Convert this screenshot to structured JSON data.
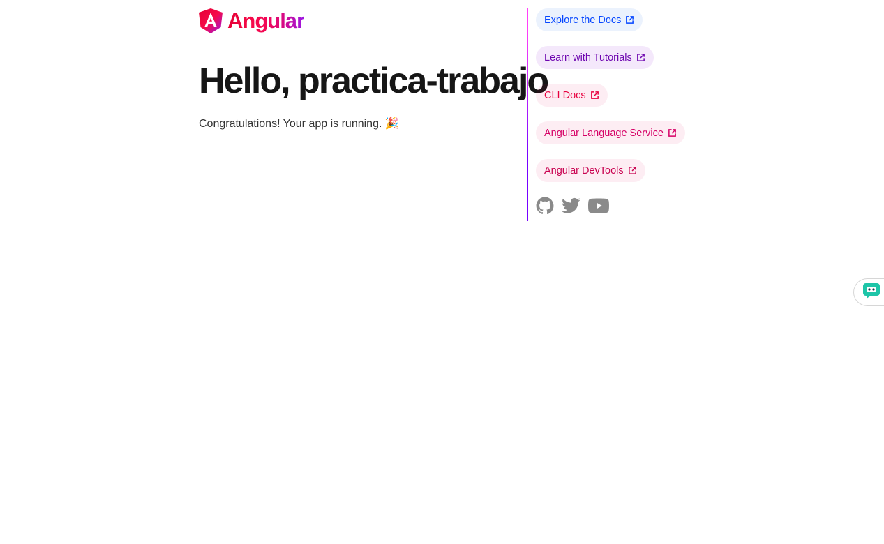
{
  "brand": {
    "logo_icon": "angular-logo-icon",
    "name": "Angular"
  },
  "main": {
    "title": "Hello, practica-trabajo",
    "subtitle": "Congratulations! Your app is running. 🎉"
  },
  "links": [
    {
      "label": "Explore the Docs",
      "icon": "external-link-icon"
    },
    {
      "label": "Learn with Tutorials",
      "icon": "external-link-icon"
    },
    {
      "label": "CLI Docs",
      "icon": "external-link-icon"
    },
    {
      "label": "Angular Language Service",
      "icon": "external-link-icon"
    },
    {
      "label": "Angular DevTools",
      "icon": "external-link-icon"
    }
  ],
  "socials": [
    {
      "icon": "github-icon"
    },
    {
      "icon": "twitter-icon"
    },
    {
      "icon": "youtube-icon"
    }
  ],
  "chat_widget": {
    "icon": "chat-bot-icon"
  },
  "colors": {
    "accent_blue": "#0546ff",
    "accent_purple": "#6e06b0",
    "accent_red": "#e8003f",
    "chat_teal": "#1ec5a8",
    "social_gray": "#8a8a8a"
  }
}
